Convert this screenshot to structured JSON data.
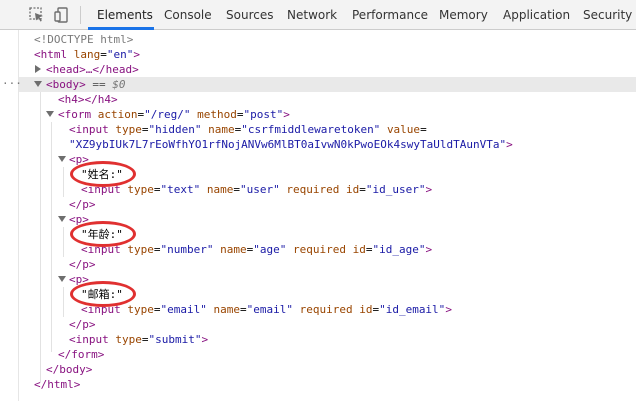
{
  "toolbar": {
    "tabs": [
      "Elements",
      "Console",
      "Sources",
      "Network",
      "Performance",
      "Memory",
      "Application",
      "Security"
    ],
    "active_tab": "Elements",
    "inspect_icon": "cursor-select-icon",
    "device_icon": "device-toggle-icon"
  },
  "tree": {
    "doctype": "<!DOCTYPE html>",
    "html_open_tag": "<html",
    "html_lang_attr": "lang",
    "html_lang_val": "\"en\"",
    "html_open_close": ">",
    "head_collapsed": "<head>…</head>",
    "body_tag": "<body>",
    "selected_marker_eq": " == ",
    "selected_marker_var": "$0",
    "h4": "<h4></h4>",
    "form_open": "<form",
    "form_action_attr": "action",
    "form_action_val": "\"/reg/\"",
    "form_method_attr": "method",
    "form_method_val": "\"post\"",
    "form_open_close": ">",
    "hidden_input_open": "<input",
    "hidden_type_attr": "type",
    "hidden_type_val": "\"hidden\"",
    "hidden_name_attr": "name",
    "hidden_name_val": "\"csrfmiddlewaretoken\"",
    "hidden_value_attr": "value",
    "hidden_value_val": "\"XZ9ybIUk7L7rEoWfhYO1rfNojANVw6MlBT0aIvwN0kPwoEOk4swyTaUldTAunVTa\"",
    "input_close": ">",
    "p_open": "<p>",
    "p_close": "</p>",
    "field1_label": "\"姓名:\"",
    "field1_input_type": "\"text\"",
    "field1_input_name": "\"user\"",
    "field1_input_id": "\"id_user\"",
    "field2_label": "\"年龄:\"",
    "field2_input_type": "\"number\"",
    "field2_input_name": "\"age\"",
    "field2_input_id": "\"id_age\"",
    "field3_label": "\"邮箱:\"",
    "field3_input_type": "\"email\"",
    "field3_input_name": "\"email\"",
    "field3_input_id": "\"id_email\"",
    "input_tag": "<input",
    "type_attr": "type",
    "name_attr": "name",
    "required_attr": "required",
    "id_attr": "id",
    "submit_type_val": "\"submit\"",
    "form_close": "</form>",
    "body_close": "</body>",
    "html_close": "</html>",
    "dots": "···"
  },
  "colors": {
    "tag": "#881280",
    "attr_name": "#994500",
    "attr_value": "#1a1aa6",
    "highlight_circle": "#e03030",
    "active_tab_underline": "#1a73e8"
  }
}
